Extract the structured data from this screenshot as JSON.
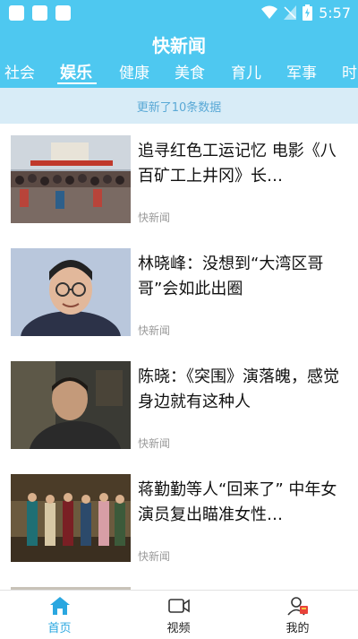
{
  "status_bar": {
    "time": "5:57"
  },
  "header": {
    "title": "快新闻",
    "tabs": [
      {
        "label": "社会"
      },
      {
        "label": "娱乐"
      },
      {
        "label": "健康"
      },
      {
        "label": "美食"
      },
      {
        "label": "育儿"
      },
      {
        "label": "军事"
      },
      {
        "label": "时"
      }
    ],
    "active_tab": "娱乐"
  },
  "refresh_notice": "更新了10条数据",
  "news": [
    {
      "title": "追寻红色工运记忆 电影《八百矿工上井冈》长…",
      "source": "快新闻"
    },
    {
      "title": "林晓峰：没想到“大湾区哥哥”会如此出圈",
      "source": "快新闻"
    },
    {
      "title": "陈晓：《突围》演落魄，感觉身边就有这种人",
      "source": "快新闻"
    },
    {
      "title": "蒋勤勤等人“回来了” 中年女演员复出瞄准女性…",
      "source": "快新闻"
    }
  ],
  "bottom_nav": [
    {
      "label": "首页",
      "icon": "home-icon"
    },
    {
      "label": "视频",
      "icon": "video-icon"
    },
    {
      "label": "我的",
      "icon": "profile-icon"
    }
  ],
  "colors": {
    "brand": "#4ec8f0",
    "active_nav": "#2aa7e0",
    "refresh_bg": "#d8ecf7"
  }
}
